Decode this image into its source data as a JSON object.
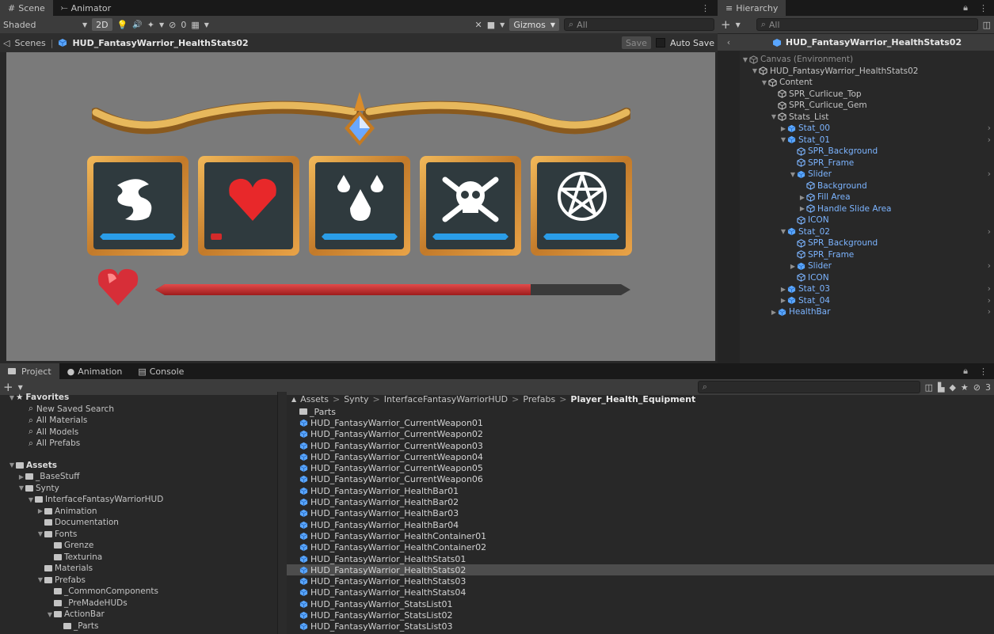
{
  "scene": {
    "tab_scene": "Scene",
    "tab_animator": "Animator",
    "shading": "Shaded",
    "mode_2d": "2D",
    "hidden_count": "0",
    "gizmos": "Gizmos",
    "search_placeholder": "All",
    "breadcrumb_root": "Scenes",
    "breadcrumb_prefab": "HUD_FantasyWarrior_HealthStats02",
    "save": "Save",
    "auto_save": "Auto Save"
  },
  "hud": {
    "health_fill": 0.79,
    "stat_fills": [
      1,
      0.15,
      1,
      1,
      1
    ],
    "accent": "#2a9de8",
    "bar_red": "#c83232"
  },
  "hierarchy": {
    "tab": "Hierarchy",
    "search_placeholder": "All",
    "title": "HUD_FantasyWarrior_HealthStats02",
    "rows": [
      {
        "label": "Canvas (Environment)",
        "depth": 0,
        "arrow": "▼",
        "icon": "go",
        "style": "dim",
        "more": false
      },
      {
        "label": "HUD_FantasyWarrior_HealthStats02",
        "depth": 1,
        "arrow": "▼",
        "icon": "go",
        "style": "",
        "more": false
      },
      {
        "label": "Content",
        "depth": 2,
        "arrow": "▼",
        "icon": "go",
        "style": "",
        "more": false
      },
      {
        "label": "SPR_Curlicue_Top",
        "depth": 3,
        "arrow": "",
        "icon": "go",
        "style": "",
        "more": false
      },
      {
        "label": "SPR_Curlicue_Gem",
        "depth": 3,
        "arrow": "",
        "icon": "go",
        "style": "",
        "more": false
      },
      {
        "label": "Stats_List",
        "depth": 3,
        "arrow": "▼",
        "icon": "go",
        "style": "",
        "more": false
      },
      {
        "label": "Stat_00",
        "depth": 4,
        "arrow": "▶",
        "icon": "prefab",
        "style": "blue",
        "more": true
      },
      {
        "label": "Stat_01",
        "depth": 4,
        "arrow": "▼",
        "icon": "prefab",
        "style": "blue",
        "more": true
      },
      {
        "label": "SPR_Background",
        "depth": 5,
        "arrow": "",
        "icon": "go",
        "style": "blue",
        "more": false
      },
      {
        "label": "SPR_Frame",
        "depth": 5,
        "arrow": "",
        "icon": "go",
        "style": "blue",
        "more": false
      },
      {
        "label": "Slider",
        "depth": 5,
        "arrow": "▼",
        "icon": "prefab",
        "style": "blue",
        "more": true
      },
      {
        "label": "Background",
        "depth": 6,
        "arrow": "",
        "icon": "go",
        "style": "blue",
        "more": false
      },
      {
        "label": "Fill Area",
        "depth": 6,
        "arrow": "▶",
        "icon": "go",
        "style": "blue",
        "more": false
      },
      {
        "label": "Handle Slide Area",
        "depth": 6,
        "arrow": "▶",
        "icon": "go",
        "style": "blue",
        "more": false
      },
      {
        "label": "ICON",
        "depth": 5,
        "arrow": "",
        "icon": "go",
        "style": "blue",
        "more": false
      },
      {
        "label": "Stat_02",
        "depth": 4,
        "arrow": "▼",
        "icon": "prefab",
        "style": "blue",
        "more": true
      },
      {
        "label": "SPR_Background",
        "depth": 5,
        "arrow": "",
        "icon": "go",
        "style": "blue",
        "more": false
      },
      {
        "label": "SPR_Frame",
        "depth": 5,
        "arrow": "",
        "icon": "go",
        "style": "blue",
        "more": false
      },
      {
        "label": "Slider",
        "depth": 5,
        "arrow": "▶",
        "icon": "prefab",
        "style": "blue",
        "more": true
      },
      {
        "label": "ICON",
        "depth": 5,
        "arrow": "",
        "icon": "go",
        "style": "blue",
        "more": false
      },
      {
        "label": "Stat_03",
        "depth": 4,
        "arrow": "▶",
        "icon": "prefab",
        "style": "blue",
        "more": true
      },
      {
        "label": "Stat_04",
        "depth": 4,
        "arrow": "▶",
        "icon": "prefab",
        "style": "blue",
        "more": true
      },
      {
        "label": "HealthBar",
        "depth": 3,
        "arrow": "▶",
        "icon": "prefab",
        "style": "blue",
        "more": true
      }
    ]
  },
  "bottom": {
    "tab_project": "Project",
    "tab_animation": "Animation",
    "tab_console": "Console",
    "hidden_count": "3",
    "breadcrumb": [
      "Assets",
      "Synty",
      "InterfaceFantasyWarriorHUD",
      "Prefabs",
      "Player_Health_Equipment"
    ],
    "favorites_label": "Favorites",
    "favorites": [
      "New Saved Search",
      "All Materials",
      "All Models",
      "All Prefabs"
    ],
    "tree": [
      {
        "label": "Assets",
        "depth": 0,
        "arrow": "▼",
        "bold": true,
        "open": true
      },
      {
        "label": "_BaseStuff",
        "depth": 1,
        "arrow": "▶",
        "bold": false,
        "open": false
      },
      {
        "label": "Synty",
        "depth": 1,
        "arrow": "▼",
        "bold": false,
        "open": true
      },
      {
        "label": "InterfaceFantasyWarriorHUD",
        "depth": 2,
        "arrow": "▼",
        "bold": false,
        "open": true
      },
      {
        "label": "Animation",
        "depth": 3,
        "arrow": "▶",
        "bold": false,
        "open": false
      },
      {
        "label": "Documentation",
        "depth": 3,
        "arrow": "",
        "bold": false,
        "open": false
      },
      {
        "label": "Fonts",
        "depth": 3,
        "arrow": "▼",
        "bold": false,
        "open": true
      },
      {
        "label": "Grenze",
        "depth": 4,
        "arrow": "",
        "bold": false,
        "open": false
      },
      {
        "label": "Texturina",
        "depth": 4,
        "arrow": "",
        "bold": false,
        "open": false
      },
      {
        "label": "Materials",
        "depth": 3,
        "arrow": "",
        "bold": false,
        "open": false
      },
      {
        "label": "Prefabs",
        "depth": 3,
        "arrow": "▼",
        "bold": false,
        "open": true
      },
      {
        "label": "_CommonComponents",
        "depth": 4,
        "arrow": "",
        "bold": false,
        "open": false
      },
      {
        "label": "_PreMadeHUDs",
        "depth": 4,
        "arrow": "",
        "bold": false,
        "open": false
      },
      {
        "label": "ActionBar",
        "depth": 4,
        "arrow": "▼",
        "bold": false,
        "open": true
      },
      {
        "label": "_Parts",
        "depth": 5,
        "arrow": "",
        "bold": false,
        "open": false
      }
    ],
    "files": [
      {
        "label": "_Parts",
        "type": "folder",
        "selected": false
      },
      {
        "label": "HUD_FantasyWarrior_CurrentWeapon01",
        "type": "prefab",
        "selected": false
      },
      {
        "label": "HUD_FantasyWarrior_CurrentWeapon02",
        "type": "prefab",
        "selected": false
      },
      {
        "label": "HUD_FantasyWarrior_CurrentWeapon03",
        "type": "prefab",
        "selected": false
      },
      {
        "label": "HUD_FantasyWarrior_CurrentWeapon04",
        "type": "prefab",
        "selected": false
      },
      {
        "label": "HUD_FantasyWarrior_CurrentWeapon05",
        "type": "prefab",
        "selected": false
      },
      {
        "label": "HUD_FantasyWarrior_CurrentWeapon06",
        "type": "prefab",
        "selected": false
      },
      {
        "label": "HUD_FantasyWarrior_HealthBar01",
        "type": "prefab",
        "selected": false
      },
      {
        "label": "HUD_FantasyWarrior_HealthBar02",
        "type": "prefab",
        "selected": false
      },
      {
        "label": "HUD_FantasyWarrior_HealthBar03",
        "type": "prefab",
        "selected": false
      },
      {
        "label": "HUD_FantasyWarrior_HealthBar04",
        "type": "prefab",
        "selected": false
      },
      {
        "label": "HUD_FantasyWarrior_HealthContainer01",
        "type": "prefab",
        "selected": false
      },
      {
        "label": "HUD_FantasyWarrior_HealthContainer02",
        "type": "prefab",
        "selected": false
      },
      {
        "label": "HUD_FantasyWarrior_HealthStats01",
        "type": "prefab",
        "selected": false
      },
      {
        "label": "HUD_FantasyWarrior_HealthStats02",
        "type": "prefab",
        "selected": true
      },
      {
        "label": "HUD_FantasyWarrior_HealthStats03",
        "type": "prefab",
        "selected": false
      },
      {
        "label": "HUD_FantasyWarrior_HealthStats04",
        "type": "prefab",
        "selected": false
      },
      {
        "label": "HUD_FantasyWarrior_StatsList01",
        "type": "prefab",
        "selected": false
      },
      {
        "label": "HUD_FantasyWarrior_StatsList02",
        "type": "prefab",
        "selected": false
      },
      {
        "label": "HUD_FantasyWarrior_StatsList03",
        "type": "prefab",
        "selected": false
      }
    ]
  }
}
